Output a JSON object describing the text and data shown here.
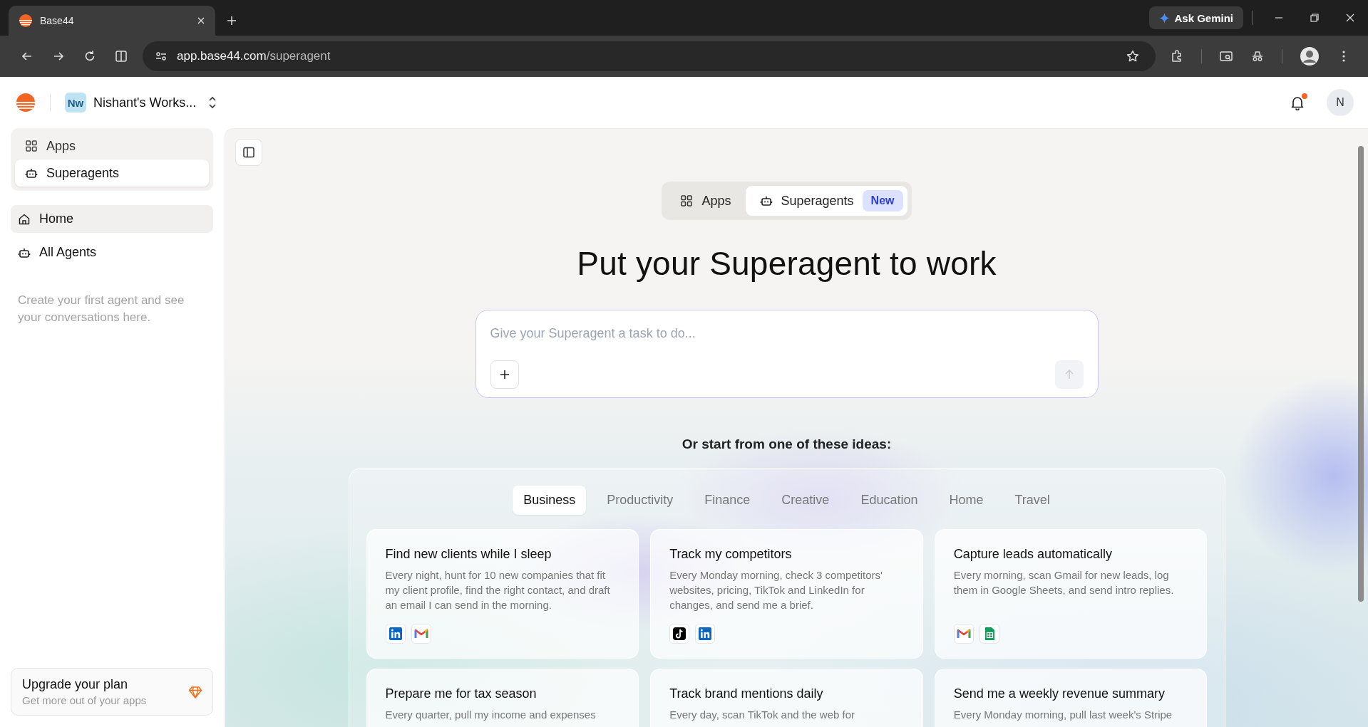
{
  "browser": {
    "tab_title": "Base44",
    "url_host": "app.base44.com",
    "url_path": "/superagent",
    "gemini_label": "Ask Gemini"
  },
  "header": {
    "workspace_badge": "Nw",
    "workspace_name": "Nishant's Works...",
    "notification": true,
    "avatar": "N"
  },
  "sidebar": {
    "switch": [
      {
        "label": "Apps",
        "kind": "apps",
        "selected": false
      },
      {
        "label": "Superagents",
        "kind": "agents",
        "selected": true
      }
    ],
    "nav": [
      {
        "label": "Home",
        "kind": "home",
        "selected": true
      },
      {
        "label": "All Agents",
        "kind": "agents",
        "selected": false
      }
    ],
    "empty_note": "Create your first agent and see your conversations here.",
    "upgrade": {
      "title": "Upgrade your plan",
      "subtitle": "Get more out of your apps"
    }
  },
  "main": {
    "toggle": [
      {
        "label": "Apps",
        "kind": "apps",
        "selected": false
      },
      {
        "label": "Superagents",
        "kind": "agents",
        "selected": true,
        "badge": "New"
      }
    ],
    "heading": "Put your Superagent to work",
    "prompt": {
      "placeholder": "Give your Superagent a task to do..."
    },
    "ideas_label": "Or start from one of these ideas:",
    "categories": [
      {
        "label": "Business",
        "selected": true
      },
      {
        "label": "Productivity",
        "selected": false
      },
      {
        "label": "Finance",
        "selected": false
      },
      {
        "label": "Creative",
        "selected": false
      },
      {
        "label": "Education",
        "selected": false
      },
      {
        "label": "Home",
        "selected": false
      },
      {
        "label": "Travel",
        "selected": false
      }
    ],
    "cards": [
      {
        "title": "Find new clients while I sleep",
        "description": "Every night, hunt for 10 new companies that fit my client profile, find the right contact, and draft an email I can send in the morning.",
        "icons": [
          {
            "kind": "linkedin"
          },
          {
            "kind": "gmail"
          }
        ]
      },
      {
        "title": "Track my competitors",
        "description": "Every Monday morning, check 3 competitors' websites, pricing, TikTok and LinkedIn for changes, and send me a brief.",
        "icons": [
          {
            "kind": "tiktok"
          },
          {
            "kind": "linkedin"
          }
        ]
      },
      {
        "title": "Capture leads automatically",
        "description": "Every morning, scan Gmail for new leads, log them in Google Sheets, and send intro replies.",
        "icons": [
          {
            "kind": "gmail"
          },
          {
            "kind": "sheets"
          }
        ]
      },
      {
        "title": "Prepare me for tax season",
        "description": "Every quarter, pull my income and expenses"
      },
      {
        "title": "Track brand mentions daily",
        "description": "Every day, scan TikTok and the web for"
      },
      {
        "title": "Send me a weekly revenue summary",
        "description": "Every Monday morning, pull last week's Stripe"
      }
    ]
  }
}
